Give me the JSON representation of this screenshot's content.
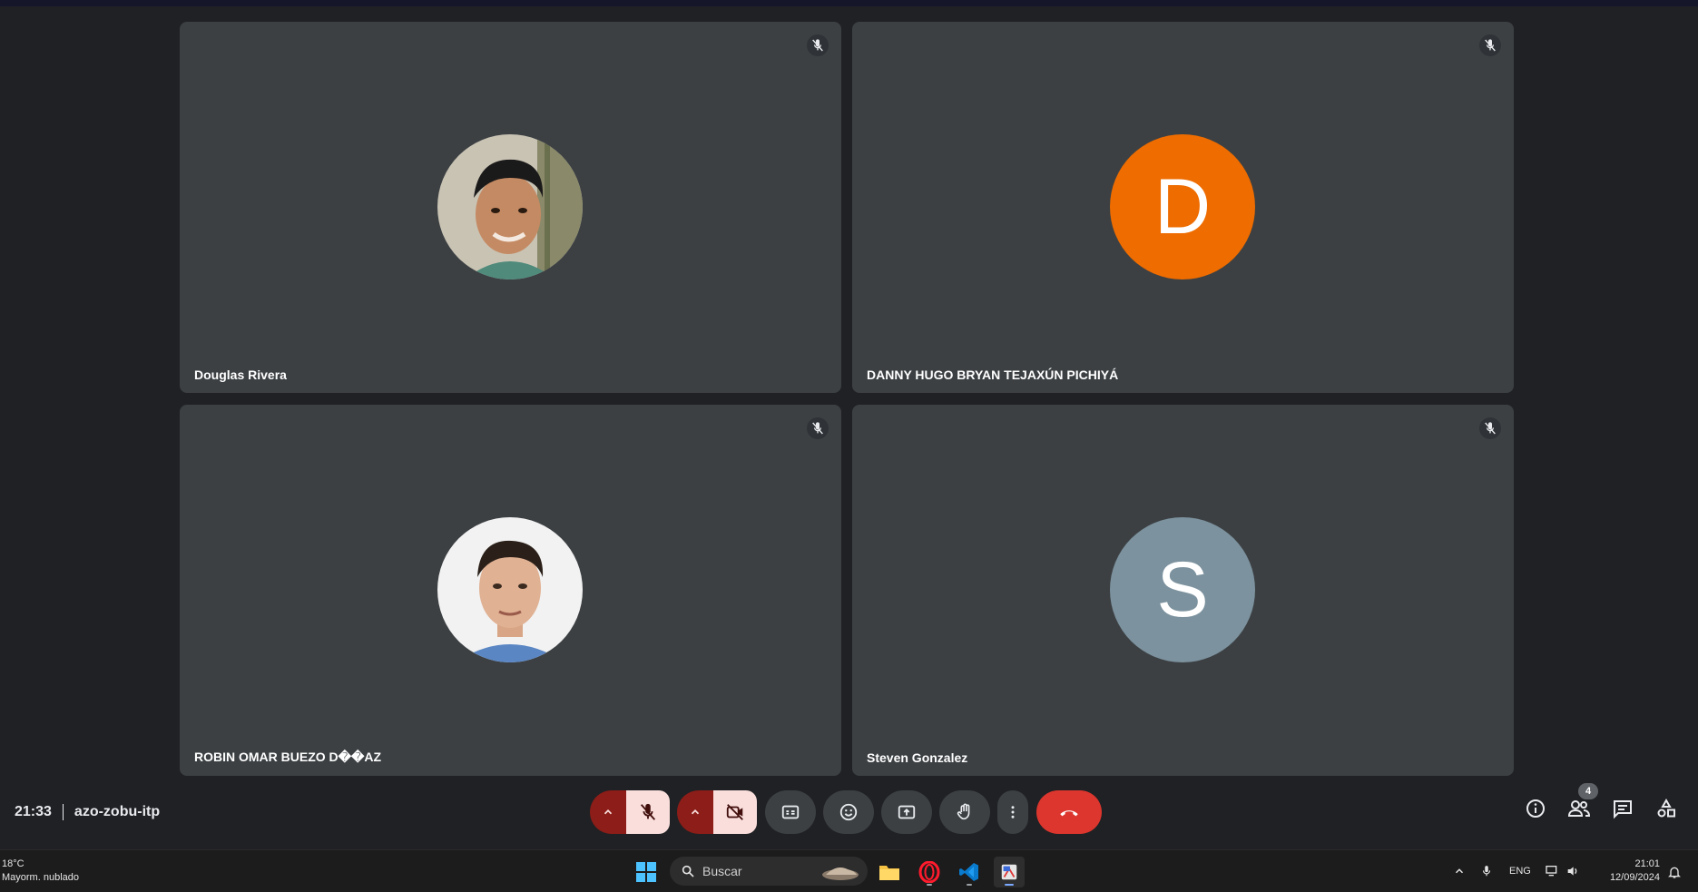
{
  "meeting": {
    "time": "21:33",
    "code": "azo-zobu-itp",
    "participant_count": "4"
  },
  "participants": [
    {
      "name": "Douglas Rivera",
      "avatar_type": "photo",
      "muted": true
    },
    {
      "name": "DANNY HUGO BRYAN TEJAXÚN PICHIYÁ",
      "avatar_type": "letter",
      "letter": "D",
      "avatar_color": "#ee6c00",
      "muted": true
    },
    {
      "name": "ROBIN OMAR BUEZO D��AZ",
      "avatar_type": "photo",
      "muted": true
    },
    {
      "name": "Steven Gonzalez",
      "avatar_type": "letter",
      "letter": "S",
      "avatar_color": "#7c929e",
      "muted": true
    }
  ],
  "controls": {
    "mic_state": "off",
    "camera_state": "off",
    "buttons": [
      "mic-options",
      "microphone",
      "camera-options",
      "camera",
      "captions",
      "reactions",
      "present",
      "raise-hand",
      "more-options",
      "leave-call"
    ],
    "right_buttons": [
      "meeting-details",
      "people",
      "chat",
      "activities"
    ],
    "colors": {
      "danger_dark": "#8c1d18",
      "danger_light": "#f9dedc",
      "leave": "#dc362e",
      "tile": "#3c4043",
      "background": "#202124"
    }
  },
  "taskbar": {
    "weather_temp": "18°C",
    "weather_desc": "Mayorm. nublado",
    "search_placeholder": "Buscar",
    "language": "ENG",
    "clock_time": "21:01",
    "clock_date": "12/09/2024",
    "apps": [
      "windows-start",
      "file-explorer",
      "opera",
      "vscode",
      "snipping-tool"
    ]
  }
}
